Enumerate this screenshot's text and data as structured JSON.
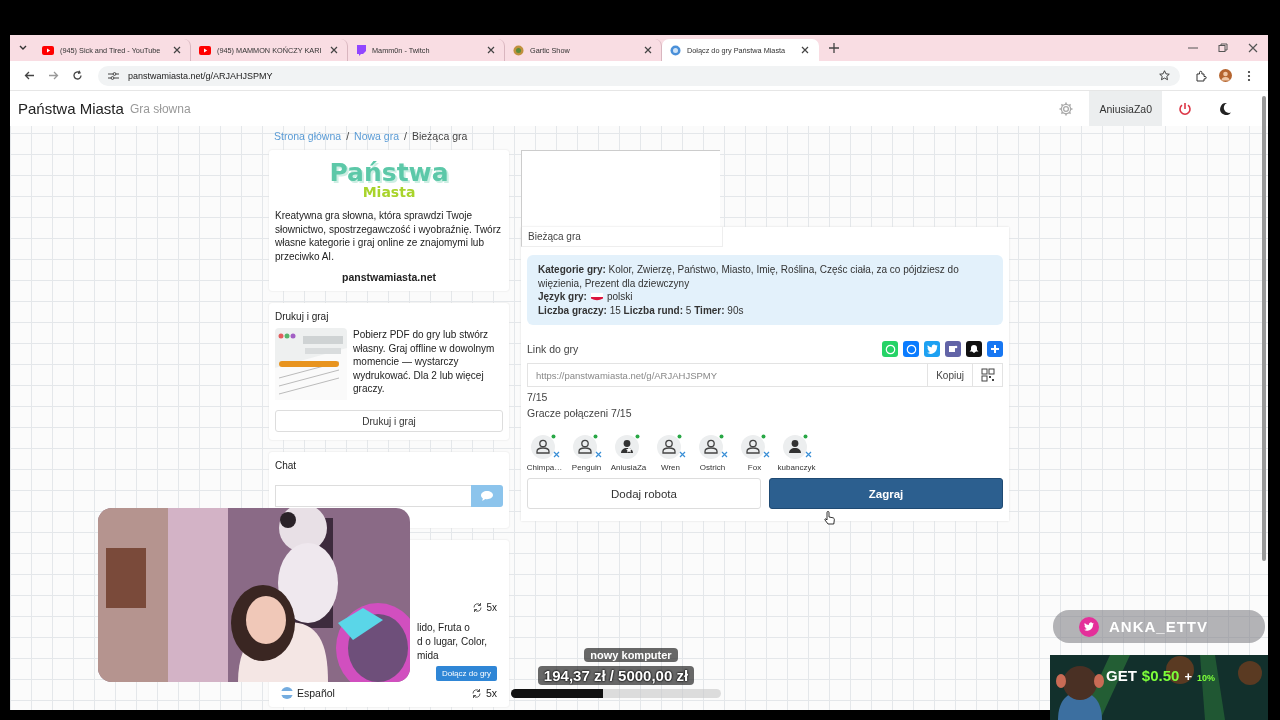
{
  "browser": {
    "tabs": [
      {
        "title": "(945) Sick and Tired - YouTube",
        "kind": "youtube",
        "selected": false
      },
      {
        "title": "(945) MAMMON KOŃCZY KARI",
        "kind": "youtube",
        "selected": false
      },
      {
        "title": "Mamm0n - Twitch",
        "kind": "twitch",
        "selected": false
      },
      {
        "title": "Gartic Show",
        "kind": "gartic",
        "selected": false
      },
      {
        "title": "Dołącz do gry Państwa Miasta",
        "kind": "site",
        "selected": true
      }
    ],
    "url": "panstwamiasta.net/g/ARJAHJSPMY"
  },
  "header": {
    "title": "Państwa Miasta",
    "subtitle": "Gra słowna",
    "user": "AniusiaZa0"
  },
  "breadcrumb": {
    "separator": "/",
    "items": [
      {
        "label": "Strona główna",
        "kind": "link"
      },
      {
        "label": "Nowa gra",
        "kind": "link"
      },
      {
        "label": "Bieżąca gra",
        "kind": "current"
      }
    ]
  },
  "about": {
    "logo_top": "Państwa",
    "logo_bottom": "Miasta",
    "description": "Kreatywna gra słowna, która sprawdzi Twoje słownictwo, spostrzegawczość i wyobraźnię. Twórz własne kategorie i graj online ze znajomymi lub przeciwko AI.",
    "site": "panstwamiasta.net"
  },
  "print": {
    "title": "Drukuj i graj",
    "text": "Pobierz PDF do gry lub stwórz własny. Graj offline w dowolnym momencie — wystarczy wydrukować. Dla 2 lub więcej graczy.",
    "button": "Drukuj i graj"
  },
  "chat": {
    "title": "Chat"
  },
  "other_game": {
    "rounds_top": "5x",
    "text_lines": [
      "lido, Fruta o",
      "d o lugar, Color,",
      "mida"
    ],
    "join_button": "Dołącz do gry",
    "language": "Español",
    "rounds_bottom": "5x"
  },
  "game": {
    "header": "Bieżąca gra",
    "categories": "**Kategorie gry:** Kolor, Zwierzę, Państwo, Miasto, Imię, Roślina, Częśc ciała, za co pójdziesz do więzienia, Prezent dla dziewczyny",
    "language_label": "Język gry:",
    "language": "polski",
    "counts": "**Liczba graczy:** 15 **Liczba rund:** 5 **Timer:** 90s",
    "link_label": "Link do gry",
    "share": [
      {
        "kind": "whatsapp"
      },
      {
        "kind": "messenger"
      },
      {
        "kind": "twitter"
      },
      {
        "kind": "teams"
      },
      {
        "kind": "snapchat"
      },
      {
        "kind": "more"
      }
    ],
    "link": "https://panstwamiasta.net/g/ARJAHJSPMY",
    "copy_button": "Kopiuj",
    "count": "7/15",
    "connected": "Gracze połączeni 7/15",
    "players": [
      {
        "name": "Chimpa…",
        "kind": "bot",
        "removable": true
      },
      {
        "name": "Penguin",
        "kind": "bot",
        "removable": true
      },
      {
        "name": "AniusiaZa",
        "kind": "host",
        "removable": false
      },
      {
        "name": "Wren",
        "kind": "bot",
        "removable": true
      },
      {
        "name": "Ostrich",
        "kind": "bot",
        "removable": true
      },
      {
        "name": "Fox",
        "kind": "bot",
        "removable": true
      },
      {
        "name": "kubanczyk",
        "kind": "user",
        "removable": true
      }
    ],
    "add_bot": "Dodaj robota",
    "play": "Zagraj"
  },
  "overlays": {
    "twitter_handle": "ANKA_ETTV",
    "ad": {
      "get": "GET",
      "amount": "$0.50",
      "plus": "+",
      "bonus": "10%"
    },
    "goal": {
      "title": "nowy komputer",
      "amount": "194,37 zł / 5000,00 zł",
      "level": 0.44
    }
  }
}
